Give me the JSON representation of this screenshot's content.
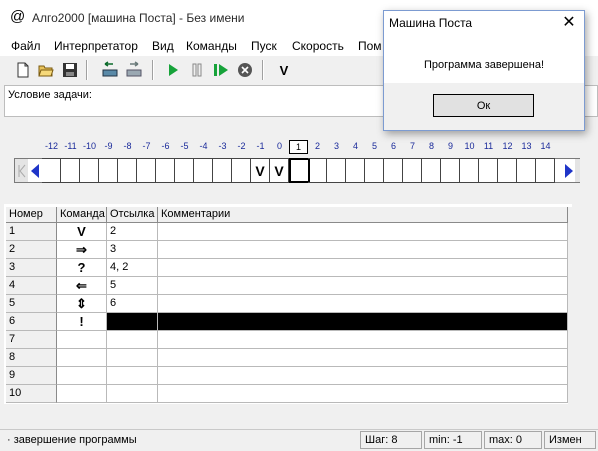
{
  "window": {
    "title": "Алго2000 [машина Поста] - Без имени",
    "icon": "@"
  },
  "menu": [
    "Файл",
    "Интерпретатор",
    "Вид",
    "Команды",
    "Пуск",
    "Скорость",
    "Пом"
  ],
  "toolbar": {
    "icons": [
      "new-file-icon",
      "open-folder-icon",
      "save-icon",
      "tape-left-icon",
      "tape-right-icon",
      "run-icon",
      "pause-icon",
      "step-icon",
      "stop-icon",
      "mark-v-icon"
    ],
    "mark_label": "V"
  },
  "condition": {
    "label": "Условие задачи:"
  },
  "tape": {
    "numbers": [
      "-12",
      "-11",
      "-10",
      "-9",
      "-8",
      "-7",
      "-6",
      "-5",
      "-4",
      "-3",
      "-2",
      "-1",
      "0",
      "1",
      "2",
      "3",
      "4",
      "5",
      "6",
      "7",
      "8",
      "9",
      "10",
      "11",
      "12",
      "13",
      "14"
    ],
    "cells": [
      "",
      "",
      "",
      "",
      "",
      "",
      "",
      "",
      "",
      "",
      "",
      "V",
      "V",
      "",
      "",
      "",
      "",
      "",
      "",
      "",
      "",
      "",
      "",
      "",
      "",
      "",
      ""
    ],
    "current_index": 13
  },
  "program": {
    "headers": [
      "Номер",
      "Команда",
      "Отсылка",
      "Комментарии"
    ],
    "rows": [
      {
        "num": "1",
        "cmd": "V",
        "ref": "2",
        "comment": ""
      },
      {
        "num": "2",
        "cmd": "⇒",
        "ref": "3",
        "comment": ""
      },
      {
        "num": "3",
        "cmd": "?",
        "ref": "4, 2",
        "comment": ""
      },
      {
        "num": "4",
        "cmd": "⇐",
        "ref": "5",
        "comment": ""
      },
      {
        "num": "5",
        "cmd": "⇕",
        "ref": "6",
        "comment": ""
      },
      {
        "num": "6",
        "cmd": "!",
        "ref": "",
        "comment": ""
      },
      {
        "num": "7",
        "cmd": "",
        "ref": "",
        "comment": ""
      },
      {
        "num": "8",
        "cmd": "",
        "ref": "",
        "comment": ""
      },
      {
        "num": "9",
        "cmd": "",
        "ref": "",
        "comment": ""
      },
      {
        "num": "10",
        "cmd": "",
        "ref": "",
        "comment": ""
      }
    ],
    "selected_row": 6
  },
  "status": {
    "message": "·  завершение программы",
    "step": "Шаг:  8",
    "min": "min: -1",
    "max": "max: 0",
    "extra": "Измен"
  },
  "dialog": {
    "title": "Машина Поста",
    "message": "Программа завершена!",
    "ok_label": "Ок"
  }
}
